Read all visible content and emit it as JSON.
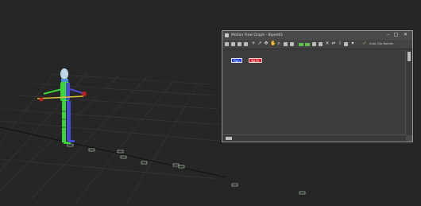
{
  "window": {
    "title": "Motion Flow Graph - Biped01",
    "min_glyph": "–",
    "max_glyph": "□",
    "close_glyph": "✕"
  },
  "toolbar": {
    "icons": [
      "move-icon",
      "sort-icon",
      "rotate-icon",
      "align-icon",
      "add-clip-icon",
      "select-icon",
      "pan-icon",
      "hand-icon",
      "zoom-icon",
      "zoom-extents-icon",
      "frame-icon",
      "create-random-motion-icon",
      "motion-icon",
      "save-icon",
      "load-icon",
      "delete-icon",
      "transition-icon",
      "info-icon",
      "link-icon",
      "dropdown-icon"
    ],
    "auto_clip_names_label": "Auto Clip Names"
  },
  "graph": {
    "nodes": [
      {
        "label": "Run",
        "color": "#1f3fd6"
      },
      {
        "label": "Walk",
        "color": "#d21f2a"
      }
    ]
  },
  "viewport": {
    "background": "#262626",
    "grid_color": "#3a3a3a",
    "biped_colors": {
      "left": "#3bd43b",
      "right": "#4a4ad0",
      "head": "#bcd6e6",
      "hand": "#c01f1f"
    }
  }
}
